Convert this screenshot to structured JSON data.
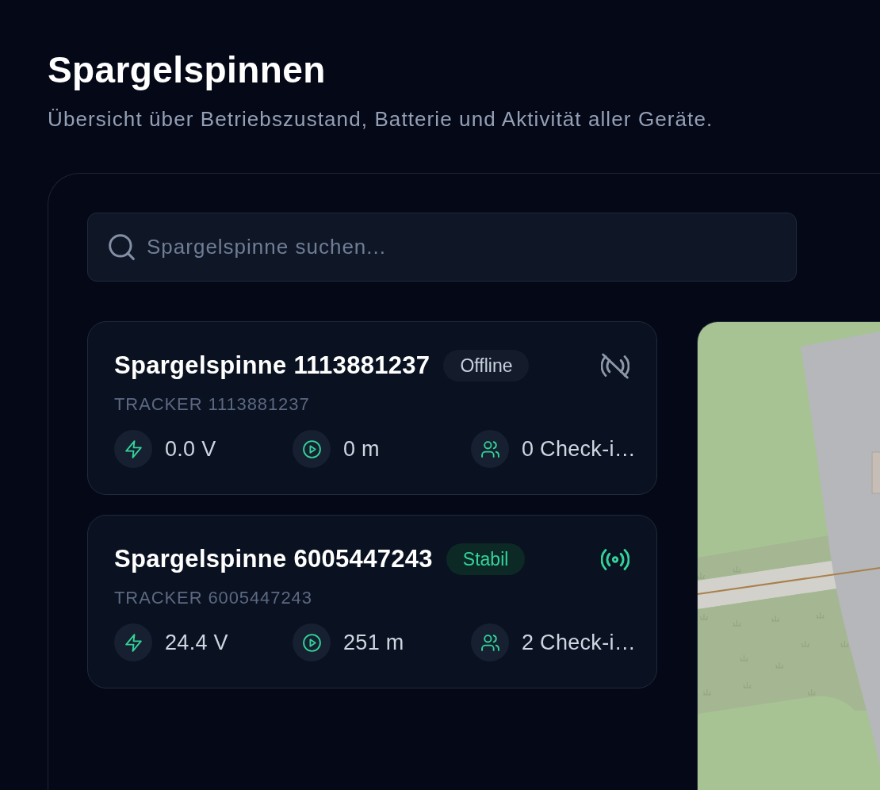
{
  "header": {
    "title": "Spargelspinnen",
    "subtitle": "Übersicht über Betriebszustand, Batterie und Aktivität aller Geräte."
  },
  "search": {
    "placeholder": "Spargelspinne suchen..."
  },
  "trackers": [
    {
      "name": "Spargelspinne 1113881237",
      "status": "Offline",
      "online": false,
      "tracker_id": "TRACKER 1113881237",
      "stats": [
        {
          "kind": "voltage",
          "value": "0.0 V"
        },
        {
          "kind": "distance",
          "value": "0 m"
        },
        {
          "kind": "checkins",
          "value": "0 Check-i…"
        }
      ]
    },
    {
      "name": "Spargelspinne 6005447243",
      "status": "Stabil",
      "online": true,
      "tracker_id": "TRACKER 6005447243",
      "stats": [
        {
          "kind": "voltage",
          "value": "24.4 V"
        },
        {
          "kind": "distance",
          "value": "251 m"
        },
        {
          "kind": "checkins",
          "value": "2 Check-i…"
        }
      ]
    }
  ]
}
